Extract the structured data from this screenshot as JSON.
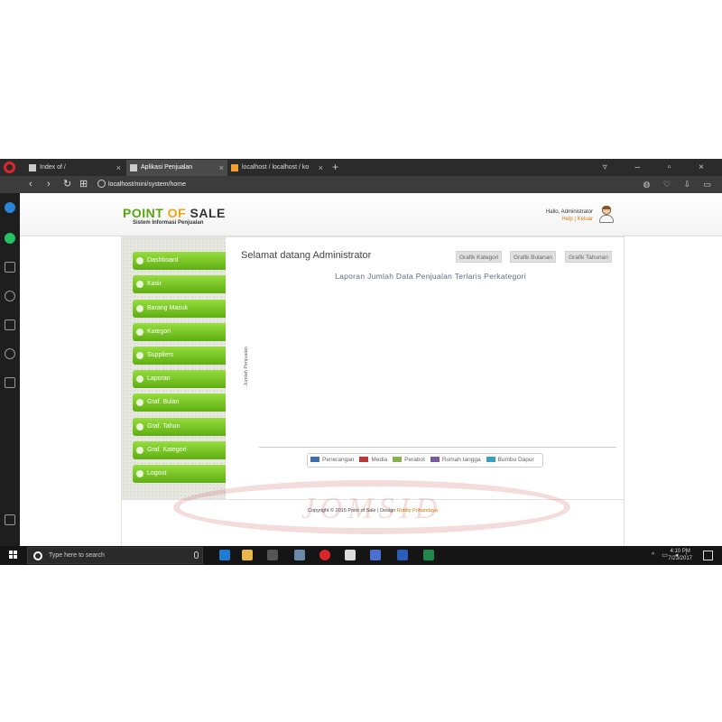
{
  "browser": {
    "tabs": [
      {
        "title": "Index of /"
      },
      {
        "title": "Aplikasi Penjualan"
      },
      {
        "title": "localhost / localhost / ko"
      }
    ],
    "url": "localhost/mini/system/home"
  },
  "header": {
    "logo": {
      "part1": "POINT",
      "part2": "OF",
      "part3": "SALE"
    },
    "subtitle": "Sistem Informasi Penjualan",
    "greeting": "Hallo, Administrator",
    "help": "Help",
    "separator": "|",
    "logout": "Keluar"
  },
  "menu": {
    "items": [
      {
        "label": "Dashboard"
      },
      {
        "label": "Kasir"
      },
      {
        "label": "Barang Masuk"
      },
      {
        "label": "Kategori"
      },
      {
        "label": "Suppliers"
      },
      {
        "label": "Laporan"
      },
      {
        "label": "Graf. Bulan"
      },
      {
        "label": "Graf. Tahun"
      },
      {
        "label": "Graf. Kategori"
      },
      {
        "label": "Logout"
      }
    ]
  },
  "content": {
    "welcome": "Selamat datang Administrator",
    "buttons": {
      "kategori": "Grafik Kategori",
      "bulanan": "Grafik Bulanan",
      "tahunan": "Grafik Tahunan"
    }
  },
  "chart_data": {
    "type": "bar",
    "title": "Laporan Jumlah Data Penjualan Terlaris Perkategori",
    "ylabel": "Jumlah Penjualan",
    "xlabel": "",
    "categories": [],
    "series": [
      {
        "name": "Penerangan",
        "color": "#3d6fa8",
        "values": []
      },
      {
        "name": "Media",
        "color": "#b43c3c",
        "values": []
      },
      {
        "name": "Perabot",
        "color": "#8aaf4d",
        "values": []
      },
      {
        "name": "Rumah tangga",
        "color": "#7a5a9a",
        "values": []
      },
      {
        "name": "Bumbu Dapur",
        "color": "#3aa0c0",
        "values": []
      }
    ],
    "legend_position": "bottom"
  },
  "footer": {
    "text": "Copyright © 2015 Point of Sale | Design",
    "author": "Robby Prihandaya"
  },
  "watermark": "JOMSID",
  "taskbar": {
    "search_placeholder": "Type here to search",
    "time": "4:10 PM",
    "date": "7/23/2017"
  }
}
